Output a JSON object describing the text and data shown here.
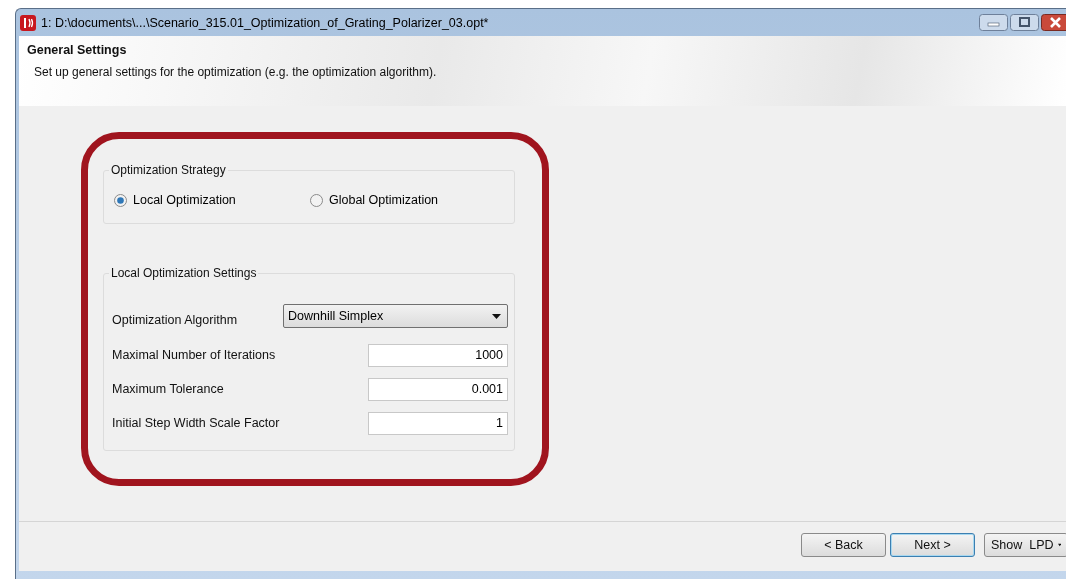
{
  "window": {
    "title": "1: D:\\documents\\...\\Scenario_315.01_Optimization_of_Grating_Polarizer_03.opt*"
  },
  "header": {
    "title": "General Settings",
    "subtitle": "Set up general settings for the optimization (e.g. the optimization algorithm)."
  },
  "strategy": {
    "label": "Optimization Strategy",
    "options": [
      {
        "label": "Local Optimization",
        "selected": true
      },
      {
        "label": "Global Optimization",
        "selected": false
      }
    ]
  },
  "local_settings": {
    "label": "Local Optimization Settings",
    "algorithm": {
      "label": "Optimization Algorithm",
      "value": "Downhill Simplex"
    },
    "fields": [
      {
        "label": "Maximal Number of Iterations",
        "value": "1000"
      },
      {
        "label": "Maximum Tolerance",
        "value": "0.001"
      },
      {
        "label": "Initial Step Width Scale Factor",
        "value": "1"
      }
    ]
  },
  "buttons": [
    {
      "label": "< Back",
      "focused": false,
      "kind": "plain"
    },
    {
      "label": "Next >",
      "focused": true,
      "kind": "plain"
    },
    {
      "label": "Show  LPD",
      "focused": false,
      "kind": "menu"
    }
  ]
}
